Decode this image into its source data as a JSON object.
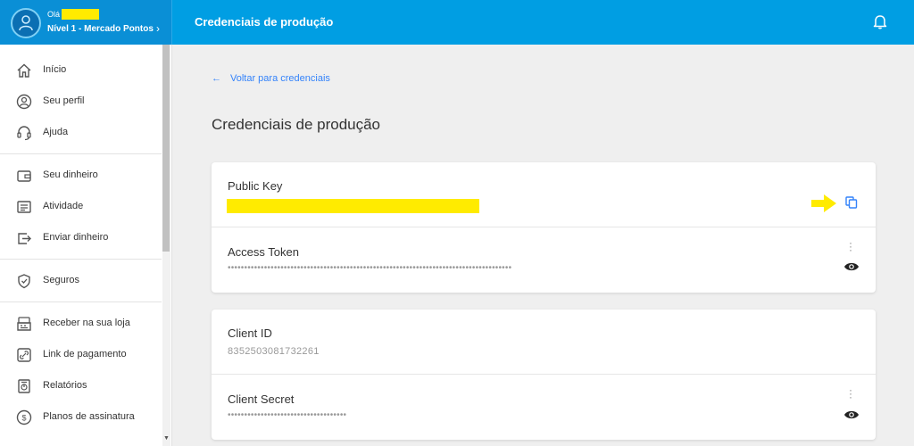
{
  "header": {
    "greeting": "Olá",
    "level": "Nível 1 - Mercado Pontos",
    "page_title": "Credenciais de produção"
  },
  "sidebar": {
    "items": [
      {
        "label": "Início",
        "icon": "home-icon"
      },
      {
        "label": "Seu perfil",
        "icon": "profile-icon"
      },
      {
        "label": "Ajuda",
        "icon": "headset-icon"
      },
      {
        "label": "Seu dinheiro",
        "icon": "wallet-icon"
      },
      {
        "label": "Atividade",
        "icon": "activity-icon"
      },
      {
        "label": "Enviar dinheiro",
        "icon": "send-money-icon"
      },
      {
        "label": "Seguros",
        "icon": "shield-icon"
      },
      {
        "label": "Receber na sua loja",
        "icon": "store-register-icon"
      },
      {
        "label": "Link de pagamento",
        "icon": "link-icon"
      },
      {
        "label": "Relatórios",
        "icon": "report-icon"
      },
      {
        "label": "Planos de assinatura",
        "icon": "subscription-icon"
      }
    ]
  },
  "main": {
    "back_link": "Voltar para credenciais",
    "title": "Credenciais de produção",
    "credentials": {
      "public_key_label": "Public Key",
      "access_token_label": "Access Token",
      "access_token_masked": "••••••••••••••••••••••••••••••••••••••••••••••••••••••••••••••••••••••••••••••••••••••",
      "client_id_label": "Client ID",
      "client_id_value": "8352503081732261",
      "client_secret_label": "Client Secret",
      "client_secret_masked": "••••••••••••••••••••••••••••••••••••"
    }
  },
  "colors": {
    "header_blue": "#009ee3",
    "link_blue": "#3483fa",
    "highlight_yellow": "#ffeb00"
  }
}
